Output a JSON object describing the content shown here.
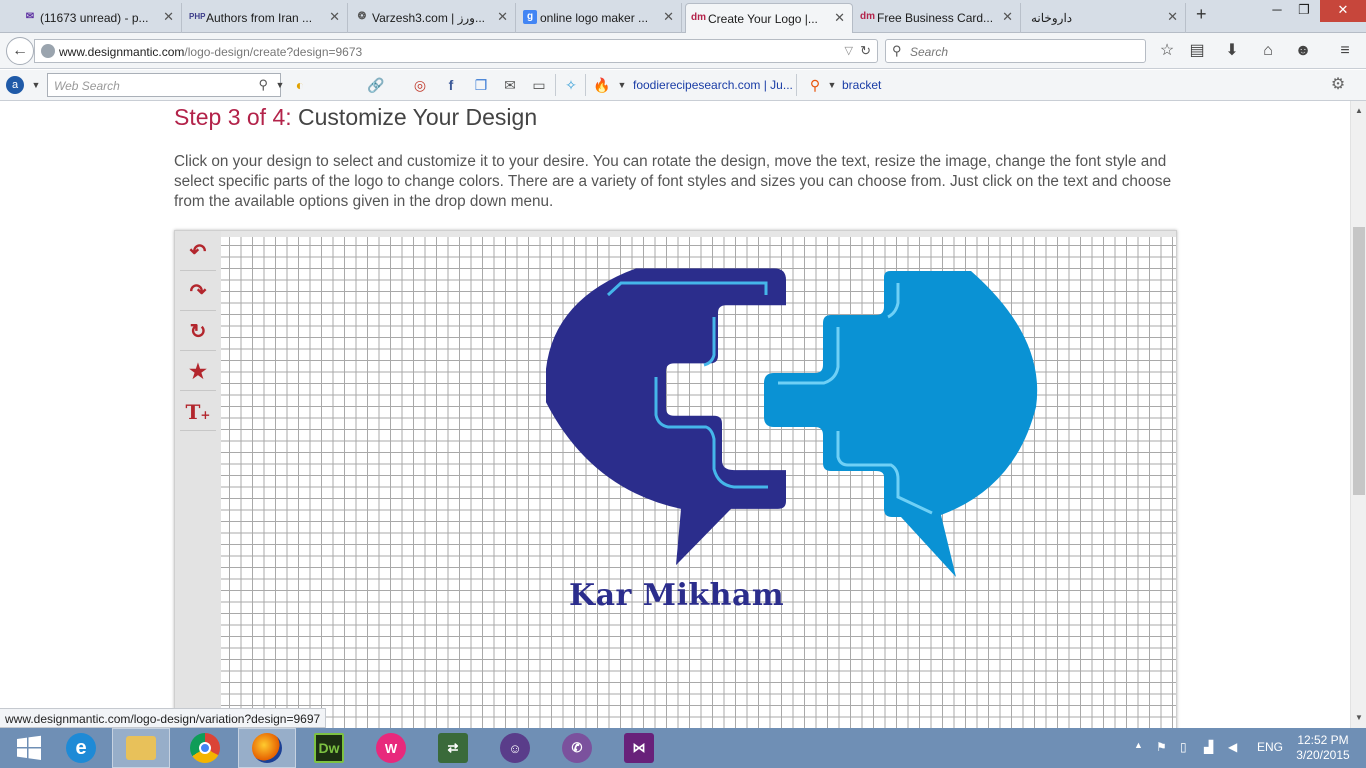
{
  "tabs": [
    {
      "title": "(11673 unread) - p...",
      "icon": "mail-icon",
      "color": "#5b2ca0"
    },
    {
      "title": "Authors from Iran ...",
      "icon": "php-icon",
      "color": "#3d3d8a"
    },
    {
      "title": "Varzesh3.com | ورز...",
      "icon": "varzesh-icon",
      "color": "#444"
    },
    {
      "title": "online logo maker ...",
      "icon": "google-icon",
      "color": "#4285f4"
    },
    {
      "title": "Create Your Logo |...",
      "icon": "dm-icon",
      "color": "#b3234a"
    },
    {
      "title": "Free Business Card...",
      "icon": "dm-icon",
      "color": "#b3234a"
    },
    {
      "title": "داروخانه",
      "icon": "",
      "color": "#444"
    }
  ],
  "nav": {
    "url_domain": "www.designmantic.com",
    "url_path": "/logo-design/create?design=9673",
    "search_placeholder": "Search"
  },
  "toolbar": {
    "web_search_placeholder": "Web Search",
    "link1": "foodierecipesearch.com | Ju...",
    "link2": "bracket"
  },
  "page": {
    "step_prefix": "Step 3 of 4:",
    "step_title": " Customize Your Design",
    "description": "Click on your design to select and customize it to your desire. You can rotate the design, move the text, resize the image, change the font style and select specific parts of the logo to change colors. There are a variety of font styles and sizes you can choose from. Just click on the text and choose from the available options given in the drop down menu."
  },
  "tools": [
    "undo-icon",
    "redo-icon",
    "rotate-icon",
    "add-shape-icon",
    "add-text-icon"
  ],
  "logo": {
    "text": "Kar Mikham",
    "colors": {
      "dark": "#2b2d8c",
      "light": "#0a92d4",
      "stripe": "#45b6ea"
    }
  },
  "status_link": "www.designmantic.com/logo-design/variation?design=9697",
  "taskbar": {
    "lang": "ENG",
    "time": "12:52 PM",
    "date": "3/20/2015"
  }
}
